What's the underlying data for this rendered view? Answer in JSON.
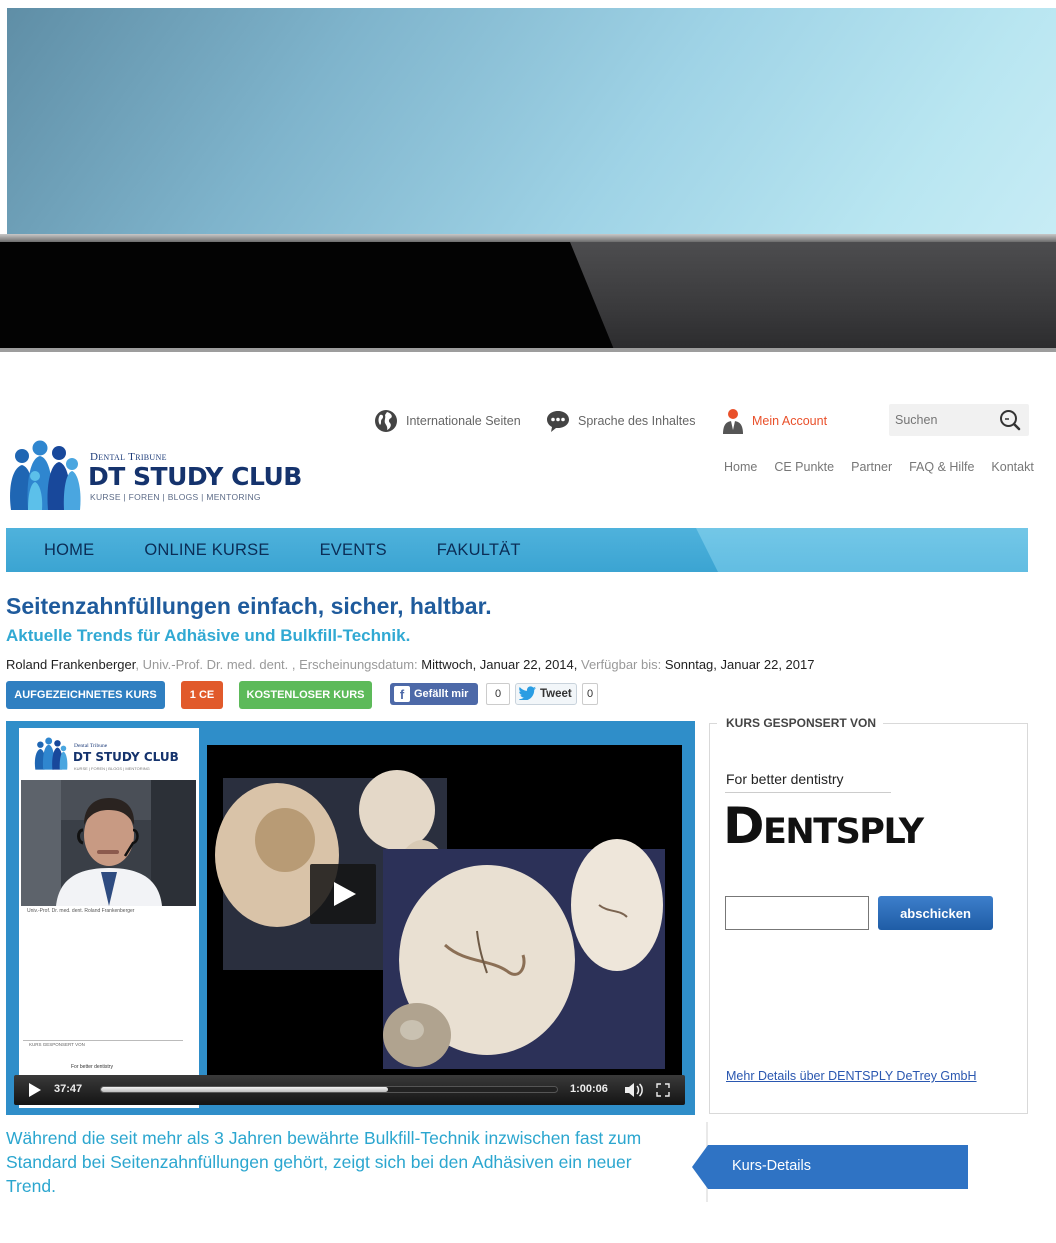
{
  "header": {
    "logo": {
      "brand_small": "Dental Tribune",
      "brand_title": "DT STUDY CLUB",
      "brand_tagline": "KURSE | FOREN | BLOGS | MENTORING"
    },
    "top_links": {
      "international": "Internationale Seiten",
      "language": "Sprache des Inhaltes",
      "account": "Mein Account"
    },
    "search": {
      "placeholder": "Suchen"
    },
    "sub_nav": [
      "Home",
      "CE Punkte",
      "Partner",
      "FAQ & Hilfe",
      "Kontakt"
    ]
  },
  "main_nav": [
    "HOME",
    "ONLINE KURSE",
    "EVENTS",
    "FAKULTÄT"
  ],
  "course": {
    "title": "Seitenzahnfüllungen einfach, sicher, haltbar.",
    "subtitle": "Aktuelle Trends für Adhäsive und Bulkfill-Technik.",
    "author": "Roland Frankenberger",
    "author_title": ", Univ.-Prof. Dr. med. dent. ,",
    "published_label": "Erscheinungsdatum:",
    "published_value": "Mittwoch, Januar 22, 2014,",
    "available_label": "Verfügbar bis:",
    "available_value": "Sonntag, Januar 22, 2017",
    "badges": {
      "recorded": "AUFGEZEICHNETES KURS",
      "ce": "1 CE",
      "free": "KOSTENLOSER KURS"
    },
    "social": {
      "like_label": "Gefällt mir",
      "like_count": "0",
      "tweet_label": "Tweet",
      "tweet_count": "0"
    },
    "intro": "Während die seit mehr als 3 Jahren bewährte Bulkfill-Technik inzwischen fast zum Standard bei Seitenzahnfüllungen gehört, zeigt sich bei den Adhäsiven ein neuer Trend.",
    "details_tab": "Kurs-Details"
  },
  "video": {
    "side_brand_small": "Dental Tribune",
    "side_brand_title": "DT STUDY CLUB",
    "side_brand_tagline": "KURSE | FOREN | BLOGS | MENTORING",
    "speaker_caption": "Univ.-Prof. Dr. med. dent. Roland Frankenberger",
    "side_sponsor_caption": "KURS GESPONSERT VON",
    "side_better": "For better dentistry",
    "elapsed": "37:47",
    "duration": "1:00:06",
    "progress": 0.63
  },
  "sponsor": {
    "heading": "KURS GESPONSERT VON",
    "tagline": "For better dentistry",
    "brand": "DENTSPLY",
    "input_value": "",
    "submit_label": "abschicken",
    "link": "Mehr Details über DENTSPLY DeTrey GmbH"
  },
  "colors": {
    "nav_bar": "#3ba4d2",
    "title_blue": "#1f5b9c",
    "accent_cyan": "#31a9d3",
    "account_orange": "#e9502a",
    "badge_blue": "#2f7fc1",
    "badge_orange": "#e15a2b",
    "badge_green": "#5dba5a"
  }
}
